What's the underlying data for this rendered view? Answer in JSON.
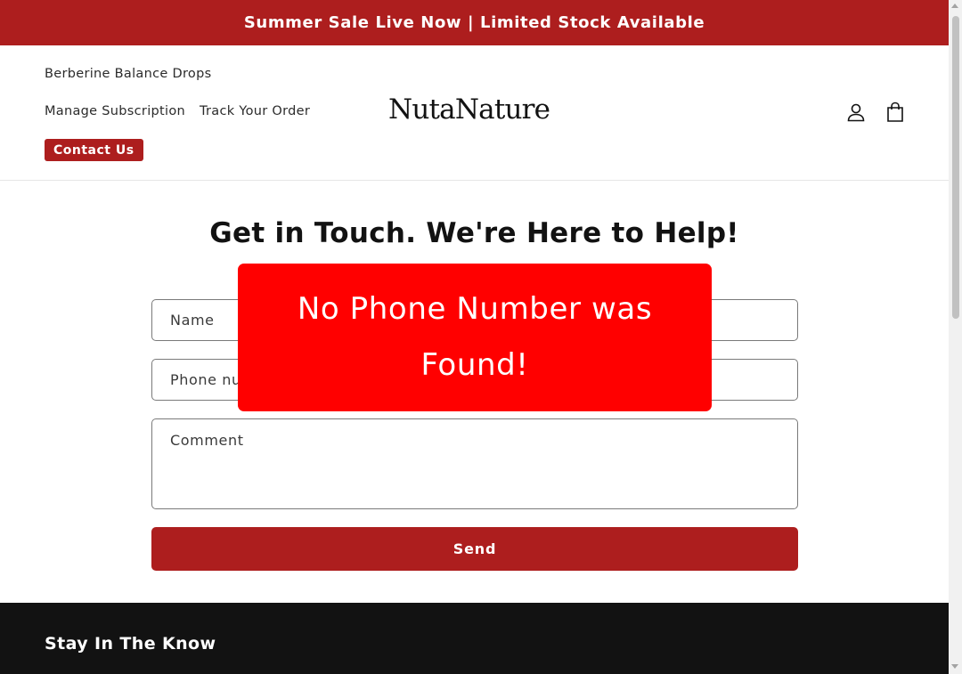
{
  "announcement": {
    "text": "Summer Sale Live Now | Limited Stock Available"
  },
  "header": {
    "nav": {
      "berberine": "Berberine Balance Drops",
      "manage_subscription": "Manage Subscription",
      "track_order": "Track Your Order",
      "contact_us": "Contact Us"
    },
    "logo": "NutaNature",
    "icons": {
      "account": "account-icon",
      "cart": "cart-icon"
    }
  },
  "main": {
    "title": "Get in Touch. We're Here to Help!",
    "form": {
      "name_placeholder": "Name",
      "email_placeholder": "",
      "phone_placeholder": "Phone number",
      "comment_placeholder": "Comment",
      "send_label": "Send"
    }
  },
  "popup": {
    "message": "No Phone Number was Found!"
  },
  "footer": {
    "heading": "Stay In The Know"
  },
  "colors": {
    "brand": "#ad1e1e",
    "popup": "#ff0000",
    "footer": "#121212"
  }
}
